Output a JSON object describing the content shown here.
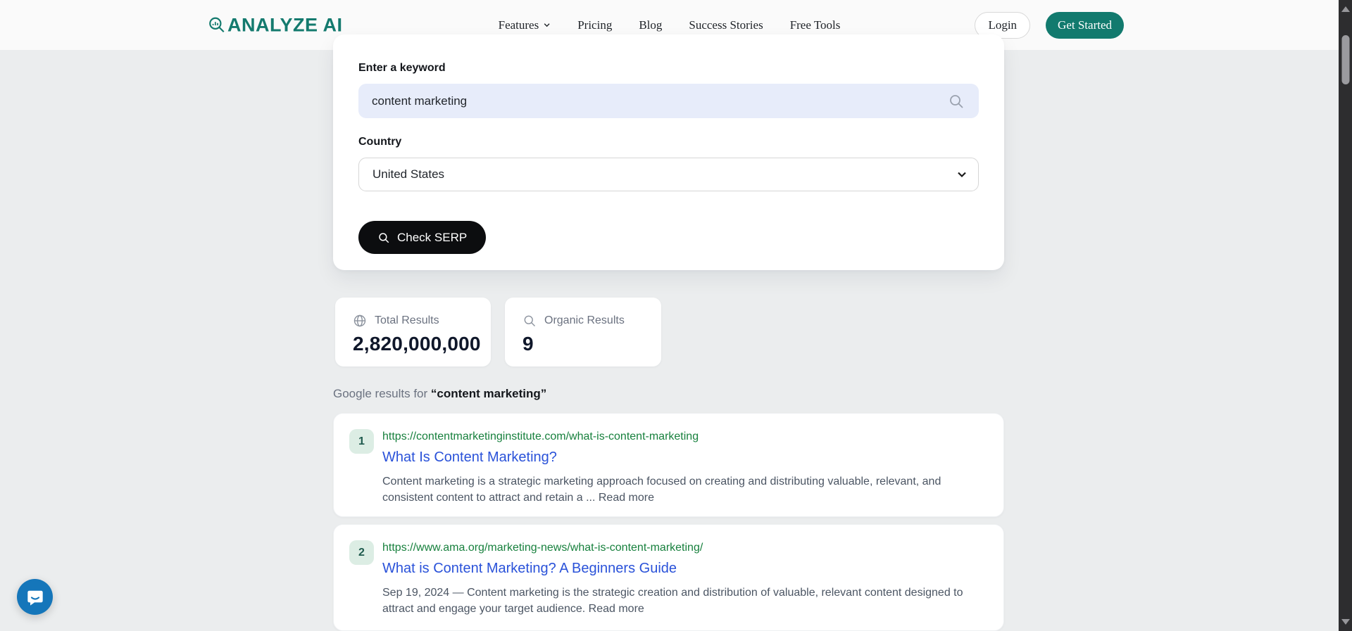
{
  "colors": {
    "brand_teal": "#127a6e",
    "header_bg": "#fafafa",
    "page_bg": "#ebedee",
    "input_bg": "#e7ecfa",
    "button_black": "#0c0d0f",
    "result_url_green": "#17803d",
    "result_title_blue": "#2a52d9",
    "rank_badge_bg": "#dcede4",
    "rank_badge_text": "#1f5b4e",
    "chat_blue": "#1576ba"
  },
  "header": {
    "logo_text": "ANALYZE AI",
    "nav": [
      {
        "label": "Features",
        "has_dropdown": true
      },
      {
        "label": "Pricing",
        "has_dropdown": false
      },
      {
        "label": "Blog",
        "has_dropdown": false
      },
      {
        "label": "Success Stories",
        "has_dropdown": false
      },
      {
        "label": "Free Tools",
        "has_dropdown": false
      }
    ],
    "login_label": "Login",
    "get_started_label": "Get Started"
  },
  "form": {
    "keyword_label": "Enter a keyword",
    "keyword_value": "content marketing",
    "country_label": "Country",
    "country_value": "United States",
    "submit_label": "Check SERP"
  },
  "stats": {
    "total": {
      "label": "Total Results",
      "value": "2,820,000,000"
    },
    "organic": {
      "label": "Organic Results",
      "value": "9"
    }
  },
  "results_heading": {
    "prefix": "Google results for ",
    "keyword_quoted": "“content marketing”"
  },
  "results": [
    {
      "rank": "1",
      "url": "https://contentmarketinginstitute.com/what-is-content-marketing",
      "title": "What Is Content Marketing?",
      "description": "Content marketing is a strategic marketing approach focused on creating and distributing valuable, relevant, and consistent content to attract and retain a ...",
      "read_more": "Read more"
    },
    {
      "rank": "2",
      "url": "https://www.ama.org/marketing-news/what-is-content-marketing/",
      "title": "What is Content Marketing? A Beginners Guide",
      "description": "Sep 19, 2024 — Content marketing is the strategic creation and distribution of valuable, relevant content designed to attract and engage your target audience.",
      "read_more": "Read more"
    }
  ]
}
